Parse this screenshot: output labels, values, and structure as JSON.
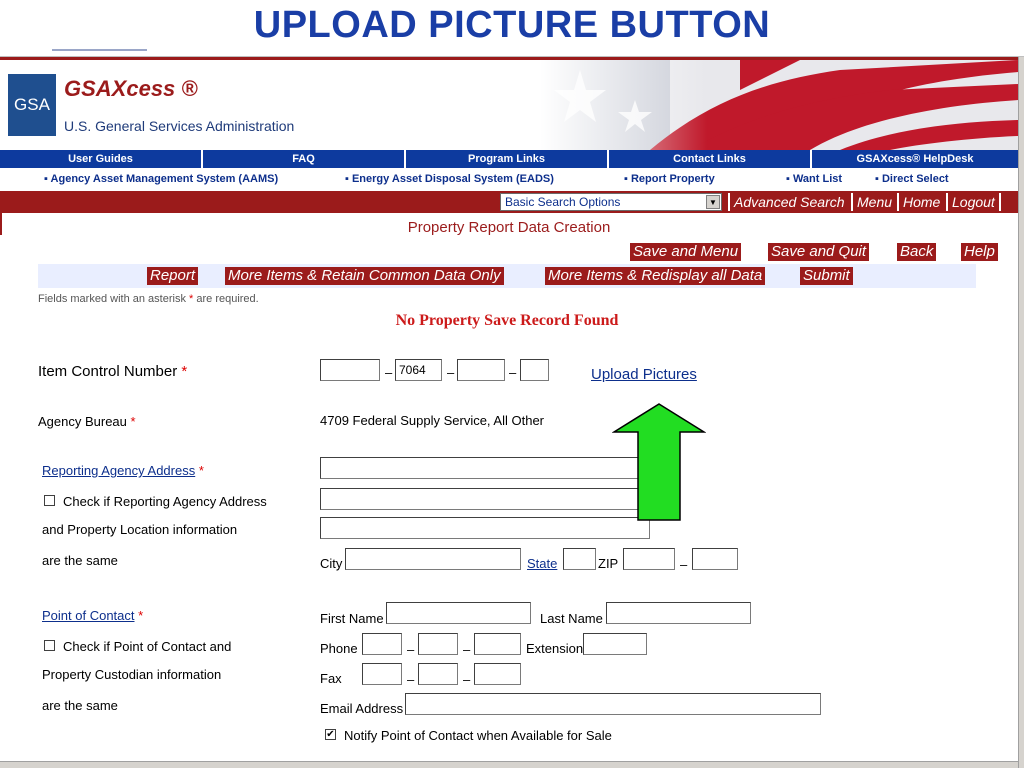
{
  "slide": {
    "title": "UPLOAD PICTURE BUTTON"
  },
  "header": {
    "logo_text": "GSA",
    "brand": "GSAXcess ®",
    "agency": "U.S. General Services Administration"
  },
  "nav": {
    "items": [
      {
        "label": "User Guides"
      },
      {
        "label": "FAQ"
      },
      {
        "label": "Program Links"
      },
      {
        "label": "Contact Links"
      },
      {
        "label": "GSAXcess® HelpDesk"
      }
    ]
  },
  "subnav": {
    "items": [
      {
        "label": "▪ Agency Asset Management System (AAMS)"
      },
      {
        "label": "▪ Energy Asset Disposal System (EADS)"
      },
      {
        "label": "▪ Report Property"
      },
      {
        "label": "▪ Want List"
      },
      {
        "label": "▪ Direct Select"
      }
    ]
  },
  "toolbar": {
    "search_select_value": "Basic Search Options",
    "buttons": [
      {
        "label": "Advanced Search"
      },
      {
        "label": "Menu"
      },
      {
        "label": "Home"
      },
      {
        "label": "Logout"
      }
    ]
  },
  "page": {
    "title": "Property Report Data Creation",
    "top_actions": [
      {
        "label": "Save and Menu"
      },
      {
        "label": "Save and Quit"
      },
      {
        "label": "Back"
      },
      {
        "label": "Help"
      }
    ],
    "strip_actions": [
      {
        "label": "Report"
      },
      {
        "label": "More Items & Retain Common Data Only"
      },
      {
        "label": "More Items & Redisplay all Data"
      },
      {
        "label": "Submit"
      }
    ],
    "fields_note_prefix": "Fields marked with an asterisk",
    "fields_note_star": "*",
    "fields_note_suffix": "are required.",
    "no_record": "No Property Save Record Found"
  },
  "form": {
    "required_star": "*",
    "item_control": {
      "label": "Item Control Number",
      "segment_values": [
        "",
        "7064",
        "",
        ""
      ],
      "dash": "–"
    },
    "upload_link": "Upload Pictures",
    "agency_bureau": {
      "label": "Agency Bureau",
      "value": "4709 Federal Supply Service, All Other"
    },
    "reporting_address": {
      "label": "Reporting Agency Address",
      "check_line1": "Check if Reporting Agency Address",
      "check_line2": "and Property Location information",
      "check_line3": "are the same",
      "city_label": "City",
      "state_label": "State",
      "zip_label": "ZIP",
      "dash": "–"
    },
    "point_of_contact": {
      "label": "Point of Contact",
      "check_line1": "Check if Point of Contact and",
      "check_line2": "Property Custodian information",
      "check_line3": "are the same",
      "first_name_label": "First Name",
      "last_name_label": "Last Name",
      "phone_label": "Phone",
      "extension_label": "Extension",
      "fax_label": "Fax",
      "email_label": "Email Address",
      "notify_label": "Notify Point of Contact when Available for Sale",
      "notify_checked": true,
      "dash": "–"
    }
  },
  "colors": {
    "brand_red": "#9b1b1b",
    "nav_blue": "#0d3a9e",
    "highlight_arrow": "#22dd22"
  }
}
